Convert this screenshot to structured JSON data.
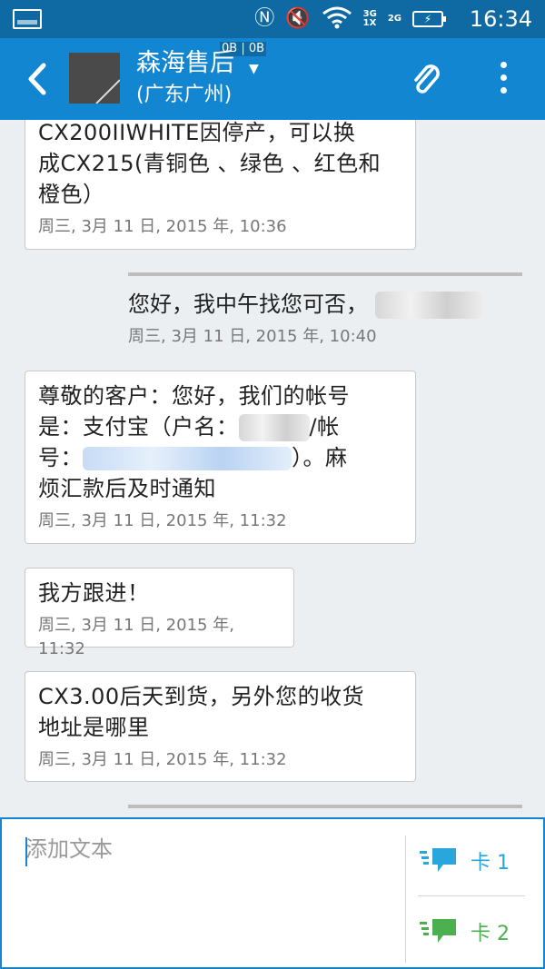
{
  "status_bar": {
    "network_3g": "3G",
    "network_1x": "1X",
    "network_2g": "2G",
    "time": "16:34"
  },
  "header": {
    "data_rate": "0B | 0B",
    "contact_name": "森海售后",
    "contact_location": "(广东广州)"
  },
  "messages": [
    {
      "direction": "incoming",
      "text_lines": [
        "CX200IIWHITE因停产，可以换",
        "成CX215(青铜色 、绿色 、红色和",
        "橙色）"
      ],
      "time": "周三, 3月 11 日, 2015 年, 10:36"
    },
    {
      "direction": "outgoing",
      "text": "您好，我中午找您可否，",
      "time": "周三, 3月 11 日, 2015 年, 10:40"
    },
    {
      "direction": "incoming",
      "text_lines": [
        "尊敬的客户：您好，我们的帐号",
        "是：支付宝（户名：",
        "/帐",
        "号：",
        "）。麻",
        "烦汇款后及时通知"
      ],
      "time": "周三, 3月 11 日, 2015 年, 11:32"
    },
    {
      "direction": "incoming",
      "text": "我方跟进！",
      "time": "周三, 3月 11 日, 2015 年, 11:32"
    },
    {
      "direction": "incoming",
      "text_lines": [
        "CX3.00后天到货，另外您的收货",
        "地址是哪里"
      ],
      "time": "周三, 3月 11 日, 2015 年, 11:32"
    }
  ],
  "composer": {
    "placeholder": "添加文本",
    "sim1_label": "卡 1",
    "sim2_label": "卡 2"
  },
  "colors": {
    "app_bar": "#1386d1",
    "status_bar": "#0f6aa3",
    "sim1": "#29a7dc",
    "sim2": "#4caf50"
  },
  "icons": [
    "back-arrow-icon",
    "attach-icon",
    "more-vert-icon",
    "send-sim1-icon",
    "send-sim2-icon",
    "nfc-icon",
    "mute-icon",
    "wifi-icon",
    "battery-charging-icon"
  ]
}
